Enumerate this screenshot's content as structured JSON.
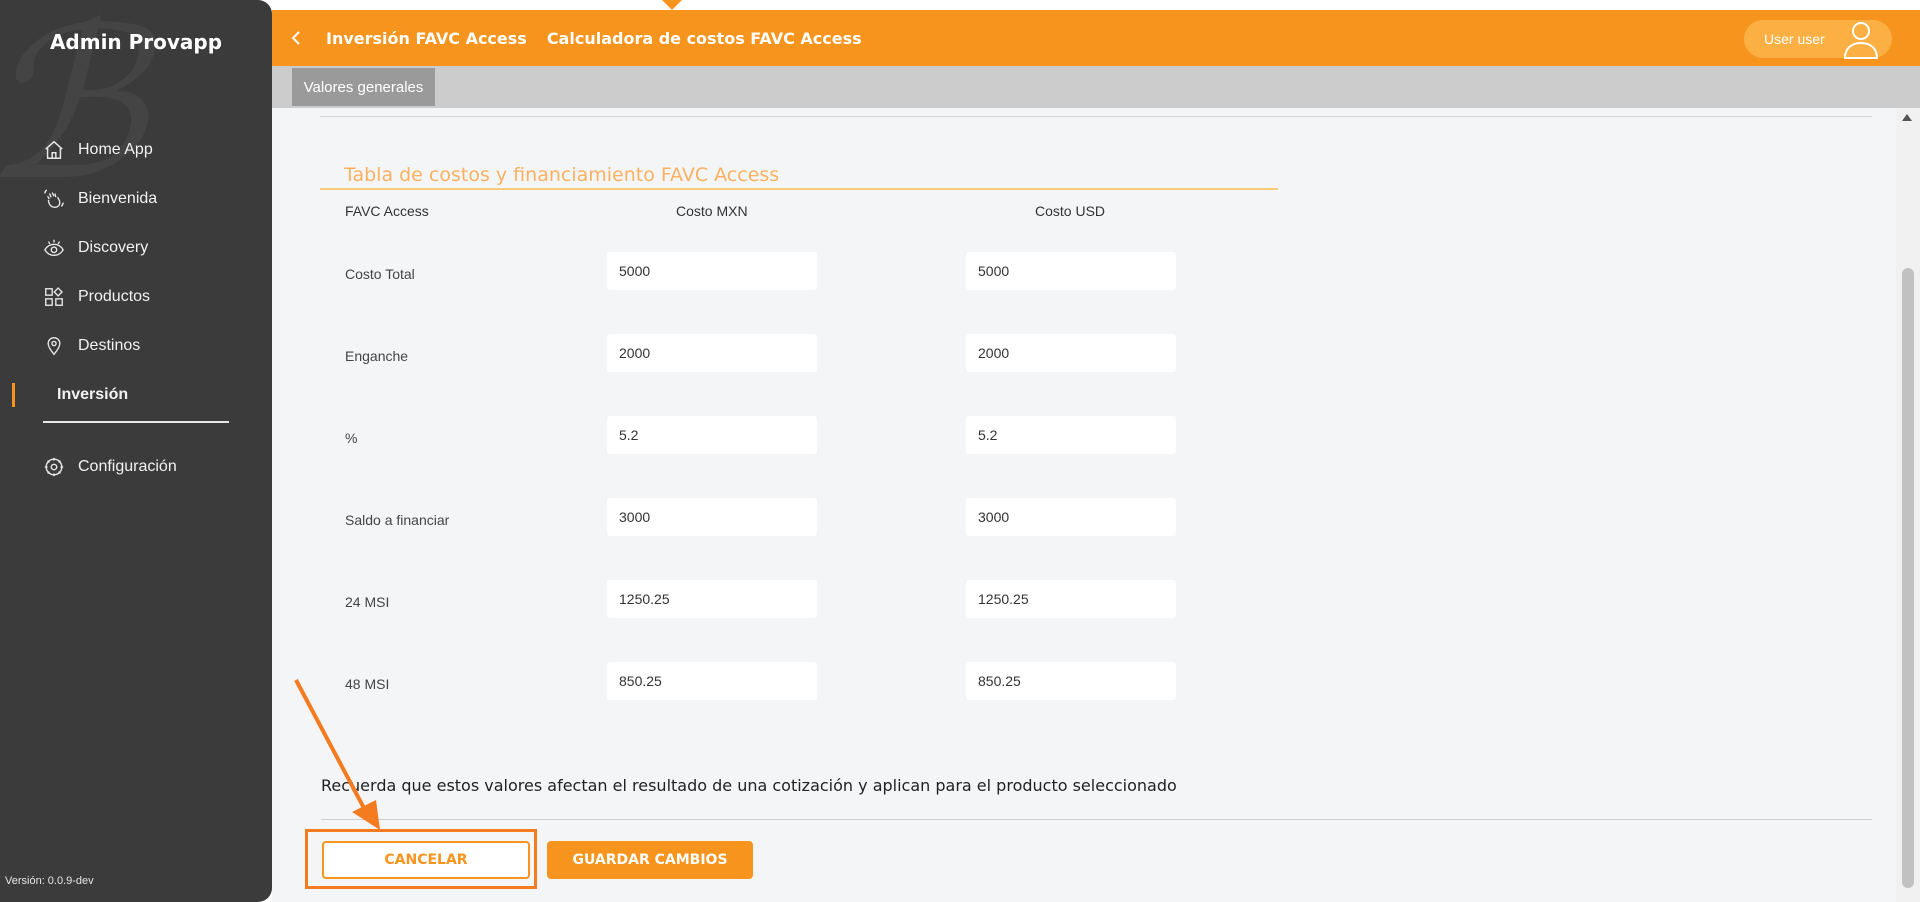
{
  "sidebar": {
    "title": "Admin Provapp",
    "items": [
      {
        "label": "Home App",
        "icon": "home-icon"
      },
      {
        "label": "Bienvenida",
        "icon": "waving-hand-icon"
      },
      {
        "label": "Discovery",
        "icon": "eye-icon"
      },
      {
        "label": "Productos",
        "icon": "grid-icon"
      },
      {
        "label": "Destinos",
        "icon": "location-pin-icon"
      },
      {
        "label": "Inversión",
        "icon": ""
      }
    ],
    "config_label": "Configuración",
    "version": "Versión: 0.0.9-dev"
  },
  "topbar": {
    "breadcrumb_parent": "Inversión FAVC Access",
    "breadcrumb_current": "Calculadora de costos FAVC Access",
    "user_name": "User user"
  },
  "subtabs": {
    "active": "Valores generales"
  },
  "table": {
    "title": "Tabla de costos y financiamiento FAVC Access",
    "headers": [
      "FAVC Access",
      "Costo MXN",
      "Costo USD"
    ],
    "rows": [
      {
        "label": "Costo Total",
        "mxn": "5000",
        "usd": "5000"
      },
      {
        "label": "Enganche",
        "mxn": "2000",
        "usd": "2000"
      },
      {
        "label": "%",
        "mxn": "5.2",
        "usd": "5.2"
      },
      {
        "label": "Saldo a financiar",
        "mxn": "3000",
        "usd": "3000"
      },
      {
        "label": "24 MSI",
        "mxn": "1250.25",
        "usd": "1250.25"
      },
      {
        "label": "48 MSI",
        "mxn": "850.25",
        "usd": "850.25"
      }
    ]
  },
  "note": "Recuerda que estos valores afectan el resultado de una cotización y aplican para el producto seleccionado",
  "buttons": {
    "cancel": "CANCELAR",
    "save": "GUARDAR CAMBIOS"
  },
  "colors": {
    "accent": "#f7941d",
    "sidebar": "#3b3b3b",
    "annotation": "#f47b20"
  }
}
